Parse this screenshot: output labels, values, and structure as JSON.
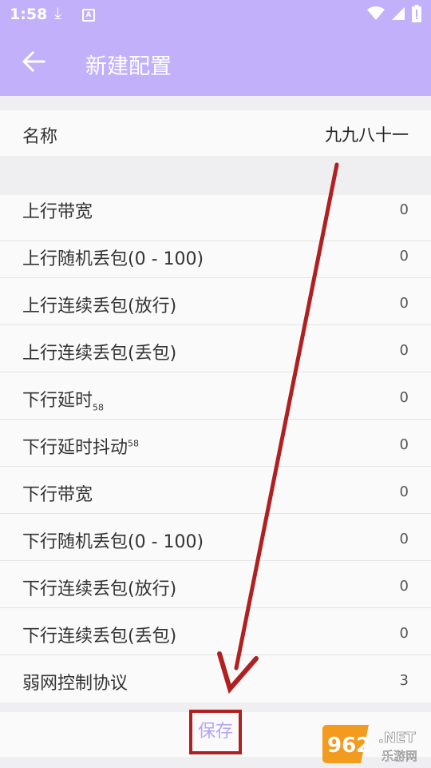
{
  "status_bar": {
    "time": "1:58",
    "a_icon_glyph": "A"
  },
  "app_bar": {
    "title": "新建配置"
  },
  "name_field": {
    "label": "名称",
    "value": "九九八十一"
  },
  "settings": [
    {
      "label": "上行带宽",
      "value": "0"
    },
    {
      "label": "上行随机丢包(0 - 100)",
      "value": "0"
    },
    {
      "label": "上行连续丢包(放行)",
      "value": "0"
    },
    {
      "label": "上行连续丢包(丢包)",
      "value": "0"
    },
    {
      "label": "下行延时",
      "suffix": "58",
      "value": "0"
    },
    {
      "label": "下行延时抖动",
      "suffix": "58",
      "value": "0"
    },
    {
      "label": "下行带宽",
      "value": "0"
    },
    {
      "label": "下行随机丢包(0 - 100)",
      "value": "0"
    },
    {
      "label": "下行连续丢包(放行)",
      "value": "0"
    },
    {
      "label": "下行连续丢包(丢包)",
      "value": "0"
    },
    {
      "label": "弱网控制协议",
      "value": "3"
    }
  ],
  "save_button": {
    "label": "保存"
  },
  "watermark": {
    "brand": "962",
    "suffix": ".NET",
    "subtitle": "乐游网"
  },
  "colors": {
    "app_bar": "#c2b0fa",
    "save_text": "#b7a4f2",
    "annotation_red": "#b02020"
  },
  "icons": {
    "status": [
      "download-icon",
      "a-app-icon",
      "wifi-icon",
      "signal-icon",
      "battery-icon"
    ],
    "app_bar": "back-arrow-icon"
  }
}
